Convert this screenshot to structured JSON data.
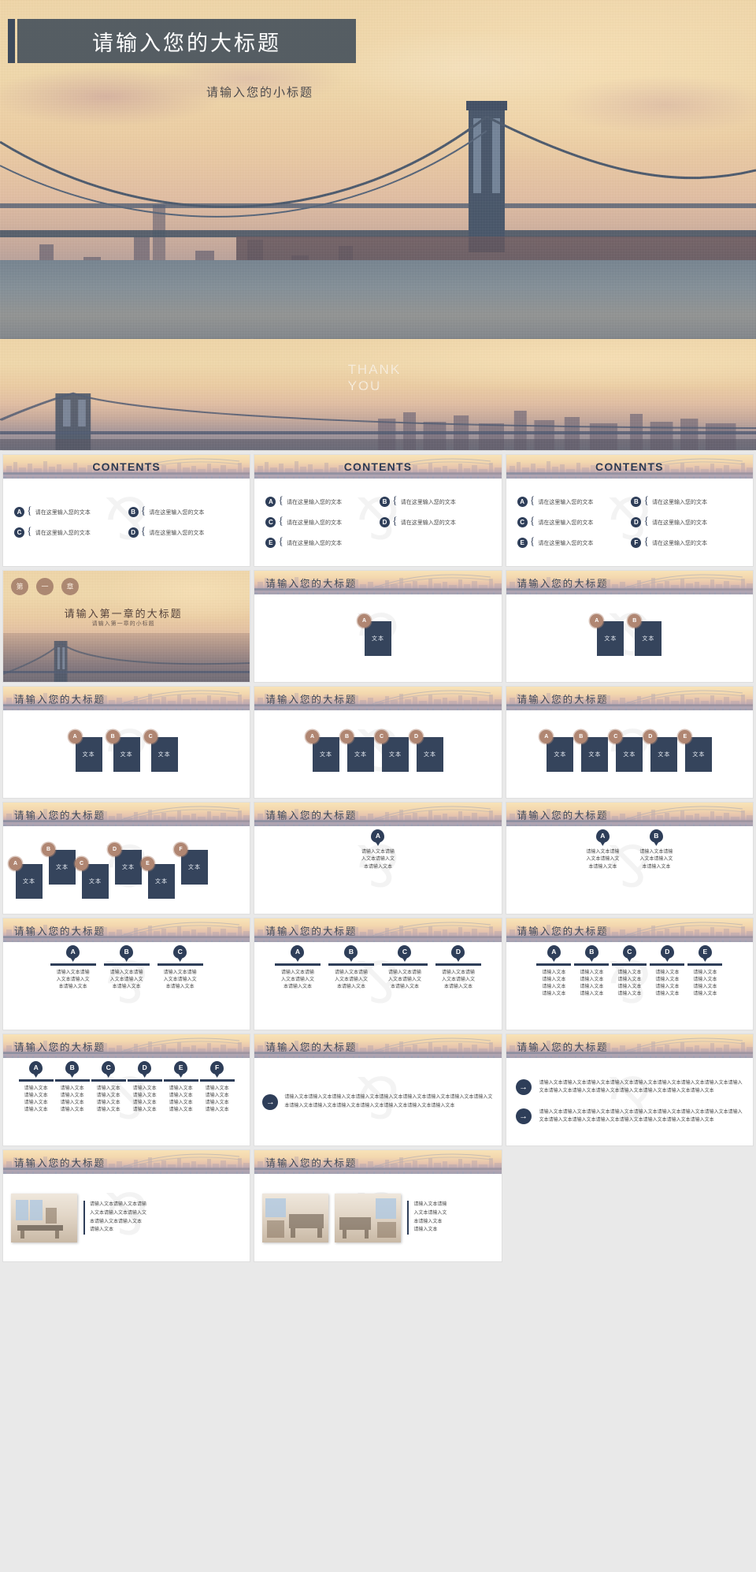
{
  "hero": {
    "title": "请输入您的大标题",
    "subtitle": "请输入您的小标题"
  },
  "labels": {
    "contents": "CONTENTS",
    "item_text": "请在这里输入您的文本",
    "slide_title_cn": "请输入您的大标题",
    "box_label": "文本",
    "chapter_title": "请输入第一章的大标题",
    "chapter_subtitle": "请输入第一章的小标题",
    "chapter_circles": [
      "第",
      "一",
      "章"
    ],
    "pin_line": "请输入文本",
    "pin_block": "请输入文本请输入文本请输入文本请输入文本",
    "paragraph": "请输入文本请输入文本请输入文本请输入文本请输入文本请输入文本请输入文本请输入文本请输入文本请输入文本请输入文本请输入文本请输入文本请输入文本请输入文本请输入文本",
    "photo_text": "请输入文本请输入文本请输入文本请输入文本请输入文本请输入文本",
    "thank_you": "THANK\nYOU",
    "badges": [
      "A",
      "B",
      "C",
      "D",
      "E",
      "F"
    ],
    "arrow_glyph": "→"
  },
  "colors": {
    "navy": "#2e3e59",
    "box_navy": "#35445c",
    "gear_brown": "#b08672",
    "title_bar": "#404c59",
    "sky_gold": "#f6d9a6"
  },
  "slides": [
    {
      "id": 1,
      "kind": "contents",
      "title": "CONTENTS",
      "cols": 1,
      "items": [
        "A"
      ]
    },
    {
      "id": 2,
      "kind": "contents",
      "title": "CONTENTS",
      "cols": 1,
      "items": [
        "A",
        "B"
      ]
    },
    {
      "id": 3,
      "kind": "contents",
      "title": "CONTENTS",
      "cols": 1,
      "items": [
        "A",
        "B",
        "C"
      ]
    },
    {
      "id": 4,
      "kind": "contents",
      "title": "CONTENTS",
      "cols": 2,
      "items": [
        "A",
        "B",
        "C",
        "D"
      ]
    },
    {
      "id": 5,
      "kind": "contents",
      "title": "CONTENTS",
      "cols": 2,
      "items": [
        "A",
        "B",
        "C",
        "D",
        "E"
      ]
    },
    {
      "id": 6,
      "kind": "contents",
      "title": "CONTENTS",
      "cols": 2,
      "items": [
        "A",
        "B",
        "C",
        "D",
        "E",
        "F"
      ]
    },
    {
      "id": 7,
      "kind": "chapter",
      "title": "请输入第一章的大标题"
    },
    {
      "id": 8,
      "kind": "boxes",
      "title": "请输入您的大标题",
      "count": 1
    },
    {
      "id": 9,
      "kind": "boxes",
      "title": "请输入您的大标题",
      "count": 2
    },
    {
      "id": 10,
      "kind": "boxes",
      "title": "请输入您的大标题",
      "count": 3
    },
    {
      "id": 11,
      "kind": "boxes",
      "title": "请输入您的大标题",
      "count": 4
    },
    {
      "id": 12,
      "kind": "boxes",
      "title": "请输入您的大标题",
      "count": 5
    },
    {
      "id": 13,
      "kind": "stagger",
      "title": "请输入您的大标题",
      "count": 6
    },
    {
      "id": 14,
      "kind": "pins",
      "title": "请输入您的大标题",
      "count": 1
    },
    {
      "id": 15,
      "kind": "pins",
      "title": "请输入您的大标题",
      "count": 2
    },
    {
      "id": 16,
      "kind": "pins",
      "title": "请输入您的大标题",
      "count": 3
    },
    {
      "id": 17,
      "kind": "pins",
      "title": "请输入您的大标题",
      "count": 4
    },
    {
      "id": 18,
      "kind": "pins",
      "title": "请输入您的大标题",
      "count": 5
    },
    {
      "id": 19,
      "kind": "pins",
      "title": "请输入您的大标题",
      "count": 6
    },
    {
      "id": 20,
      "kind": "arrow1",
      "title": "请输入您的大标题"
    },
    {
      "id": 21,
      "kind": "arrow2",
      "title": "请输入您的大标题"
    },
    {
      "id": 22,
      "kind": "photo1",
      "title": "请输入您的大标题"
    },
    {
      "id": 23,
      "kind": "photo2",
      "title": "请输入您的大标题"
    },
    {
      "id": 24,
      "kind": "thanks",
      "title": "THANK YOU"
    }
  ]
}
